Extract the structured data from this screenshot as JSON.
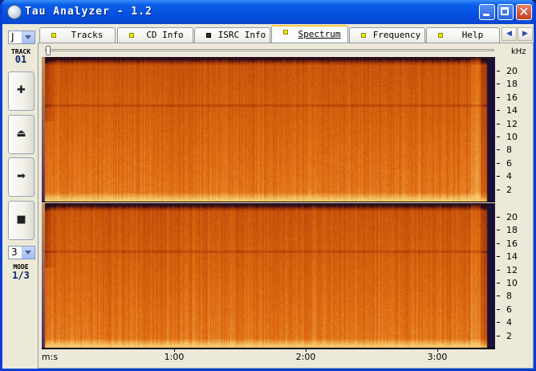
{
  "window": {
    "title": "Tau Analyzer - 1.2",
    "close_glyph": "✕"
  },
  "left_panel": {
    "drive_value": "J",
    "track_caption": "TRACK",
    "track_value": "01",
    "buttons": [
      {
        "name": "plus",
        "glyph": "✚"
      },
      {
        "name": "eject",
        "glyph": "⏏"
      },
      {
        "name": "play",
        "glyph": "➡"
      },
      {
        "name": "stop",
        "glyph": "■"
      }
    ],
    "mode_select_value": "3",
    "mode_caption": "MODE",
    "mode_value": "1/3"
  },
  "tabs": [
    {
      "label": "Tracks",
      "active": false
    },
    {
      "label": "CD Info",
      "active": false
    },
    {
      "label": "ISRC Info",
      "active": false
    },
    {
      "label": "Spectrum",
      "active": true
    },
    {
      "label": "Frequency",
      "active": false
    },
    {
      "label": "Help",
      "active": false
    }
  ],
  "tab_scroll": {
    "left": "◀",
    "right": "▶"
  },
  "spectrum": {
    "freq_unit": "kHz",
    "freq_ticks": [
      "20",
      "18",
      "16",
      "14",
      "12",
      "10",
      "8",
      "6",
      "4",
      "2"
    ],
    "time_label": "m:s",
    "time_ticks": [
      "1:00",
      "2:00",
      "3:00"
    ],
    "track_duration_s": 195,
    "colors": {
      "hot": "#f5c86a",
      "mid": "#e06a10",
      "deep": "#a83806",
      "dark": "#2a0c1a",
      "bg": "#1a1038"
    }
  }
}
